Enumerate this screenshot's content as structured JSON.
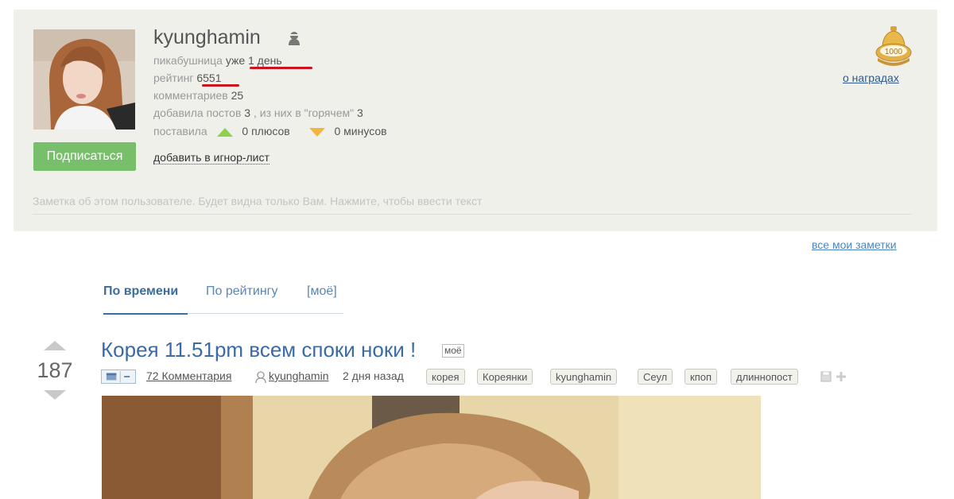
{
  "profile": {
    "username": "kyunghamin",
    "role_label": "пикабушница",
    "role_value": "уже 1 день",
    "rating_label": "рейтинг",
    "rating_value": "6551",
    "comments_label": "комментариев",
    "comments_value": "25",
    "posts_label": "добавила постов",
    "posts_value": "3",
    "hot_label": ", из них в \"горячем\"",
    "hot_value": "3",
    "votes_label": "поставила",
    "plus_text": "0 плюсов",
    "minus_text": "0 минусов",
    "subscribe_label": "Подписаться",
    "ignore_label": "добавить в игнор-лист",
    "note_placeholder": "Заметка об этом пользователе. Будет видна только Вам. Нажмите, чтобы ввести текст",
    "awards_link": "о наградах",
    "award_badge_text": "1000"
  },
  "notes": {
    "all_notes_link": "все мои заметки"
  },
  "tabs": [
    {
      "label": "По времени",
      "active": true
    },
    {
      "label": "По рейтингу",
      "active": false
    },
    {
      "label": "[моё]",
      "active": false
    }
  ],
  "post": {
    "score": "187",
    "title": "Корея 11.51pm всем споки ноки !",
    "mine_badge": "моё",
    "comments_link": "72 Комментария",
    "author": "kyunghamin",
    "time": "2 дня назад",
    "tags": [
      "корея",
      "Кореянки",
      "kyunghamin",
      "Сеул",
      "кпоп",
      "длиннопост"
    ]
  },
  "colors": {
    "accent_link": "#3b6aa6",
    "subscribe_green": "#78bf6c",
    "underline_red": "#c8141e",
    "profile_bg": "#f0f0eb"
  },
  "icons": [
    "user-icon",
    "award-crown-icon",
    "plus-triangle-icon",
    "minus-triangle-icon",
    "vote-up-icon",
    "vote-down-icon",
    "layout-icon",
    "author-icon",
    "save-icon",
    "add-tag-icon"
  ]
}
